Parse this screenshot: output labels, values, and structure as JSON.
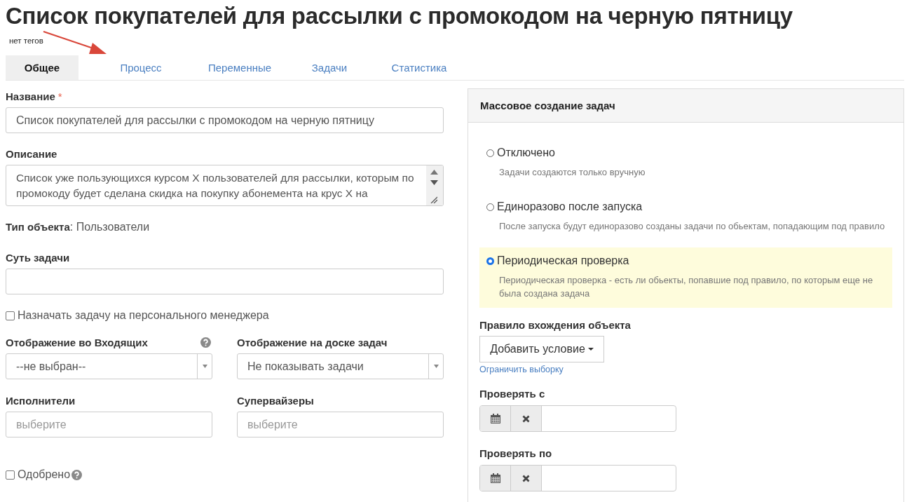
{
  "title": "Список покупателей для рассылки с промокодом на черную пятницу",
  "tags_label": "нет тегов",
  "tabs": [
    {
      "label": "Общее",
      "selected": true
    },
    {
      "label": "Процесс",
      "selected": false
    },
    {
      "label": "Переменные",
      "selected": false
    },
    {
      "label": "Задачи",
      "selected": false
    },
    {
      "label": "Статистика",
      "selected": false
    }
  ],
  "form": {
    "name": {
      "label": "Название",
      "required_mark": "*",
      "value": "Список покупателей для рассылки с промокодом на черную пятницу"
    },
    "description": {
      "label": "Описание",
      "value": "Список уже пользующихся курсом X пользователей для рассылки, которым по промокоду будет сделана скидка на покупку абонемента на крус X на"
    },
    "object_type": {
      "label": "Тип объекта",
      "separator": ":",
      "value": "Пользователи"
    },
    "task_essence": {
      "label": "Суть задачи"
    },
    "assign_manager": {
      "label": "Назначать задачу на персонального менеджера",
      "checked": false
    },
    "inbox_display": {
      "label": "Отображение во Входящих",
      "value": "--не выбран--",
      "help": true
    },
    "board_display": {
      "label": "Отображение на доске задач",
      "value": "Не показывать задачи"
    },
    "executors": {
      "label": "Исполнители",
      "placeholder": "выберите"
    },
    "supervisors": {
      "label": "Супервайзеры",
      "placeholder": "выберите"
    },
    "approved": {
      "label": "Одобрено",
      "checked": false,
      "help": true
    }
  },
  "mass_creation": {
    "title": "Массовое создание задач",
    "options": [
      {
        "label": "Отключено",
        "hint": "Задачи создаются только вручную",
        "selected": false
      },
      {
        "label": "Единоразово после запуска",
        "hint": "После запуска будут единоразово созданы задачи по обьектам, попадающим под правило",
        "selected": false
      },
      {
        "label": "Периодическая проверка",
        "hint": "Периодическая проверка - есть ли обьекты, попавшие под правило, по которым еще не была создана задача",
        "selected": true
      }
    ],
    "rule": {
      "label": "Правило вхождения объекта",
      "button": "Добавить условие",
      "link": "Ограничить выборку"
    },
    "check_from": {
      "label": "Проверять с"
    },
    "check_to": {
      "label": "Проверять по"
    }
  }
}
